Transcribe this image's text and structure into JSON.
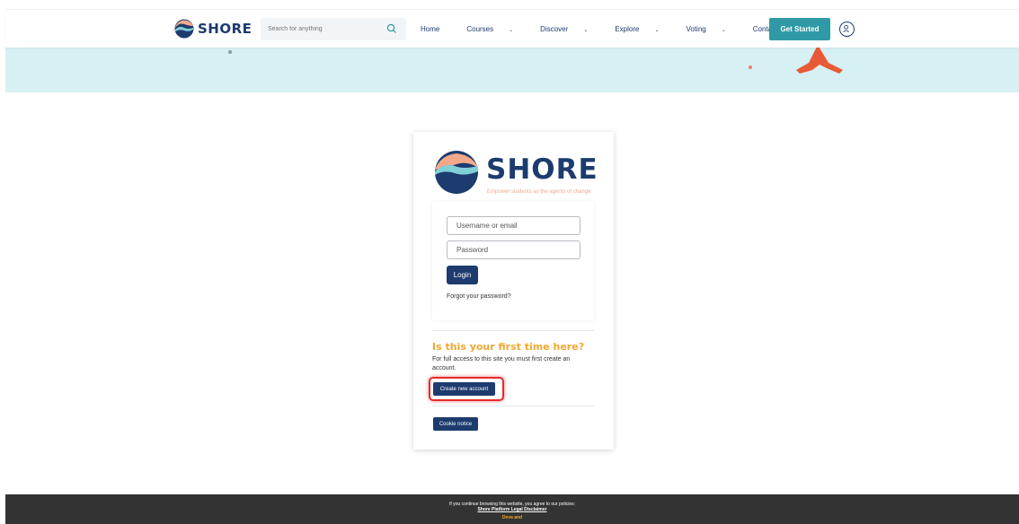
{
  "header": {
    "logo_text": "SHORE",
    "search_placeholder": "Search for anything",
    "nav": [
      {
        "label": "Home",
        "dropdown": false
      },
      {
        "label": "Courses",
        "dropdown": true
      },
      {
        "label": "Discover",
        "dropdown": true
      },
      {
        "label": "Explore",
        "dropdown": true
      },
      {
        "label": "Voting",
        "dropdown": true
      },
      {
        "label": "Contact",
        "dropdown": false
      }
    ],
    "cta_label": "Get Started",
    "user_icon": "user-icon"
  },
  "card": {
    "logo_text": "SHORE",
    "tagline": "Empower students as the agents of change",
    "username_placeholder": "Username or email",
    "password_placeholder": "Password",
    "login_label": "Login",
    "forgot_label": "Forgot your password?",
    "first_time_heading": "Is this your first time here?",
    "first_time_text": "For full access to this site you must first create an account.",
    "create_account_label": "Create new account",
    "cookie_label": "Cookie notice"
  },
  "footer": {
    "notice": "If you continue browsing this website, you agree to our policies:",
    "link": "Shore Platform Legal Disclaimer",
    "brand": "Deva and"
  },
  "colors": {
    "primary": "#1d3b6e",
    "accent": "#2f9aa6",
    "highlight": "#f0a830",
    "banner": "#d7f0f3"
  }
}
